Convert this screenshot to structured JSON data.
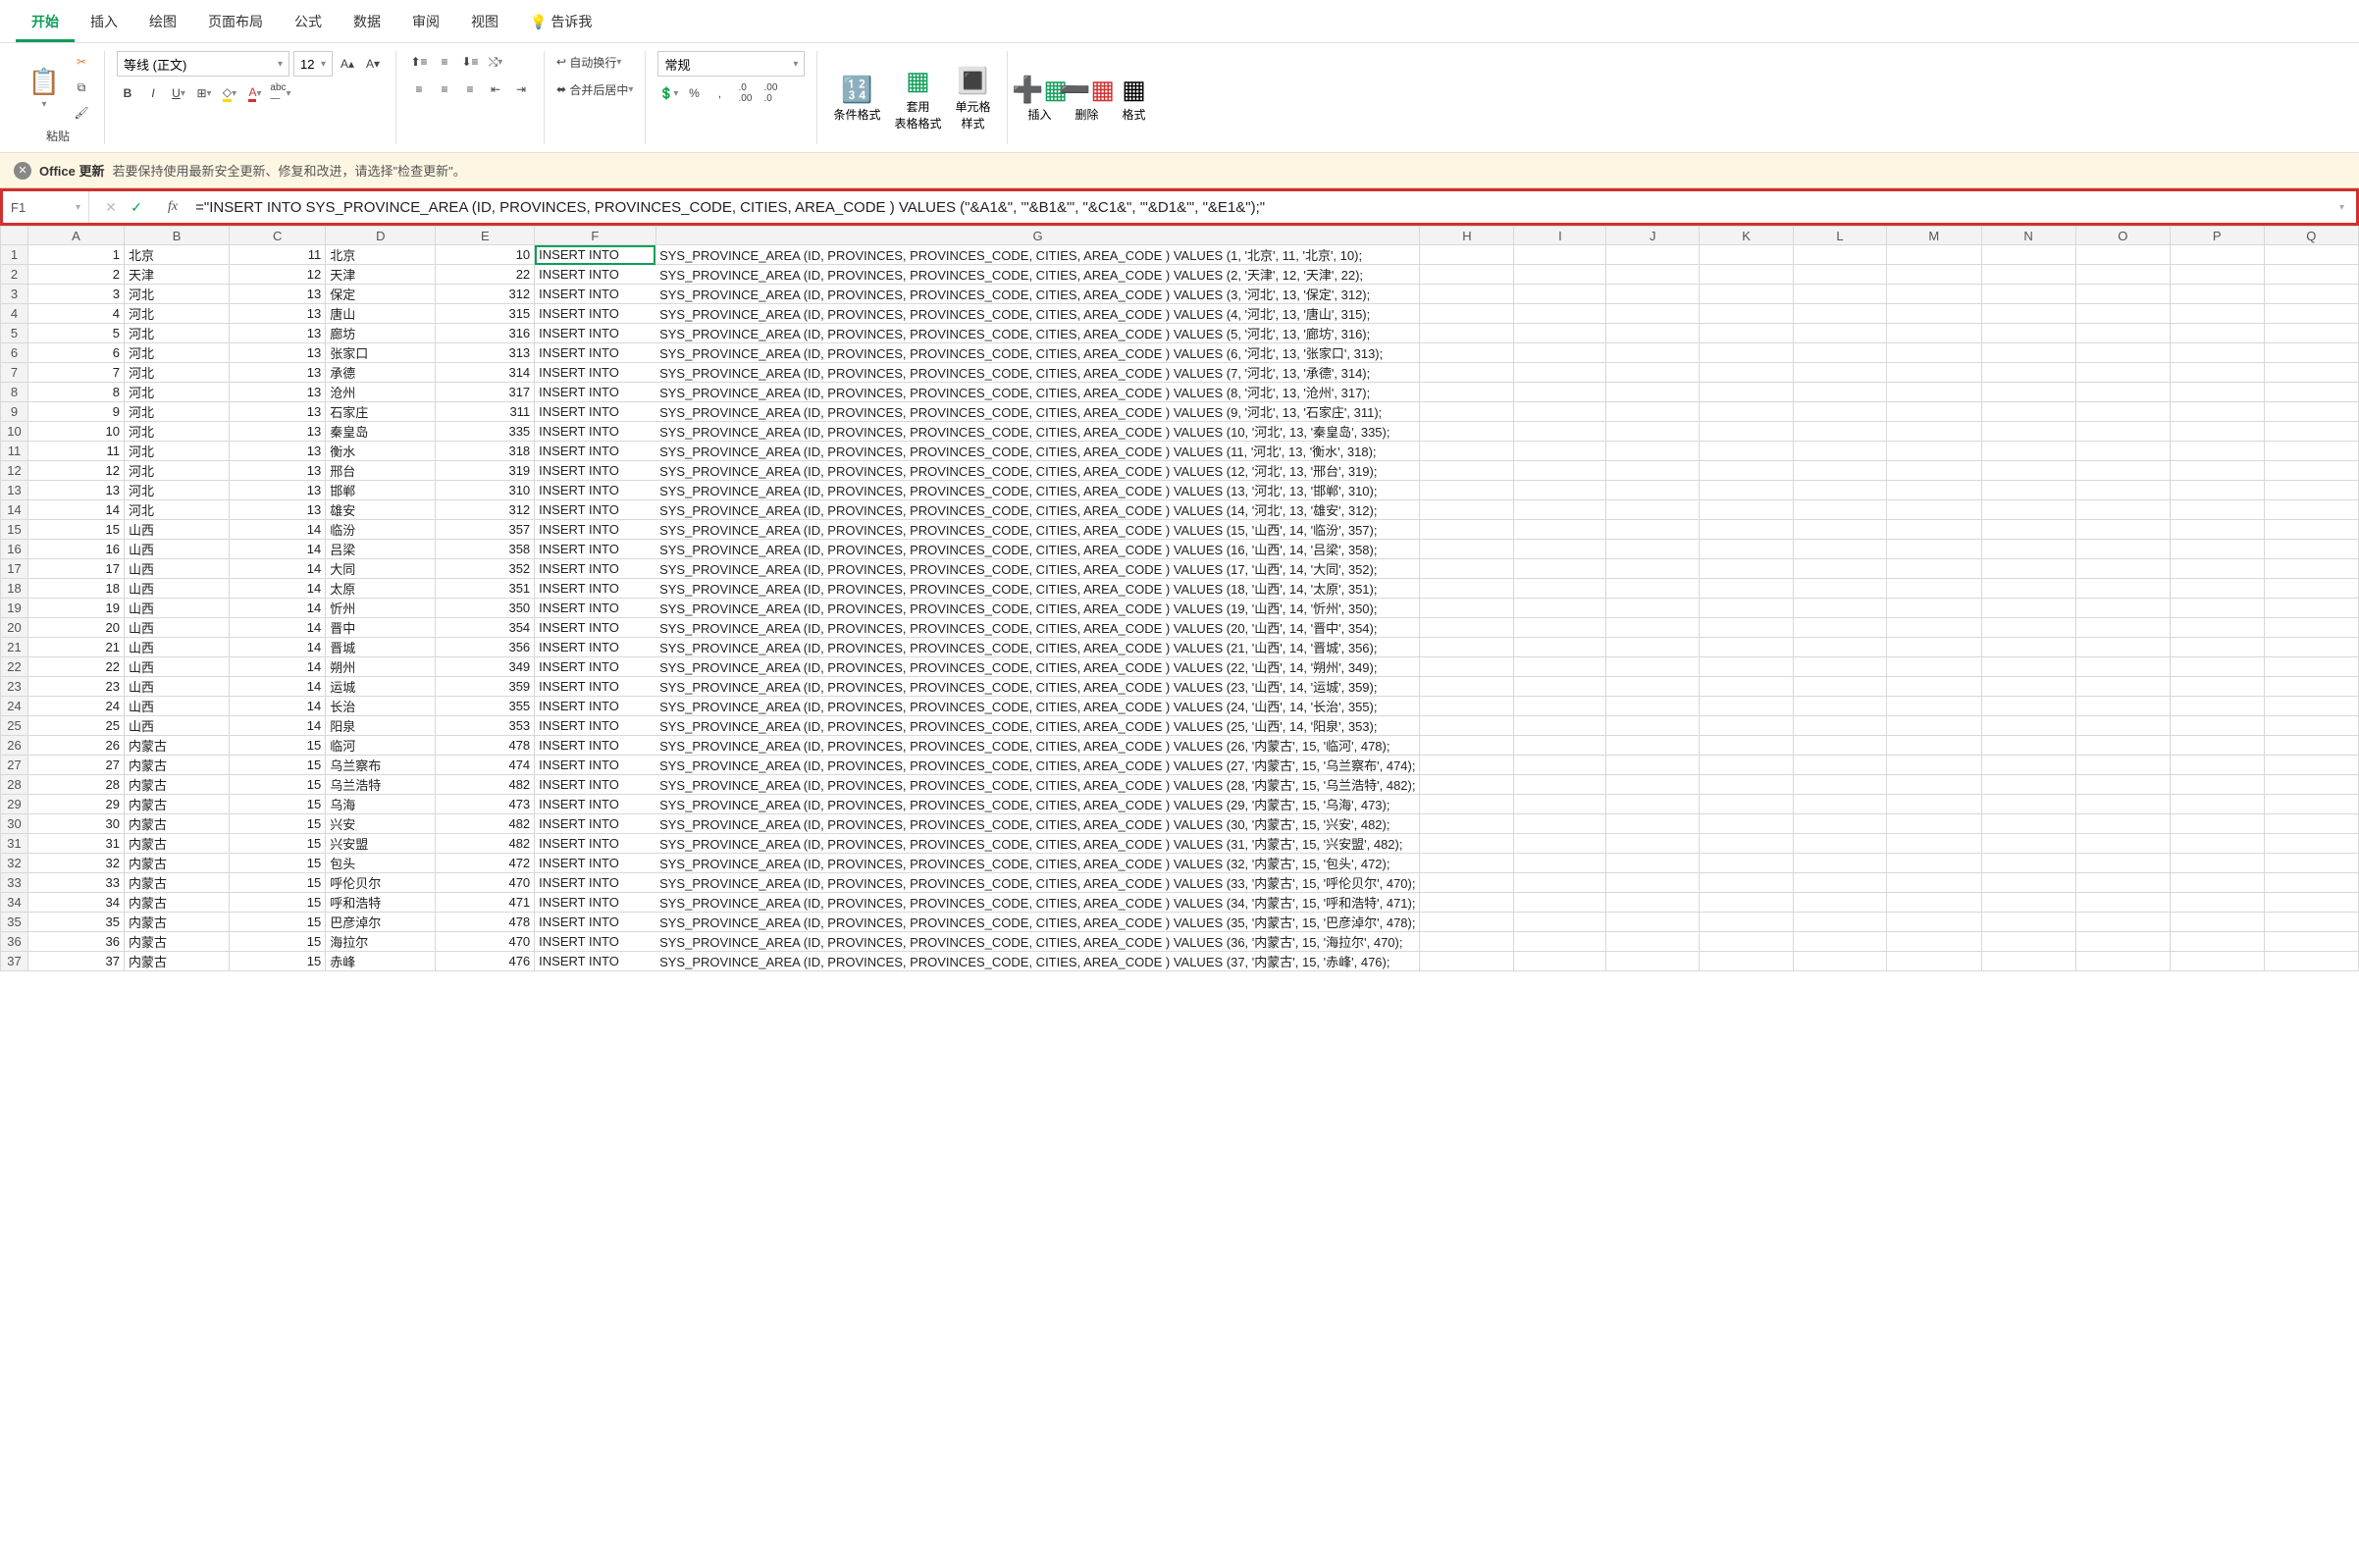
{
  "tabs": [
    "开始",
    "插入",
    "绘图",
    "页面布局",
    "公式",
    "数据",
    "审阅",
    "视图",
    "告诉我"
  ],
  "active_tab": 0,
  "ribbon": {
    "paste_label": "粘贴",
    "font_name": "等线 (正文)",
    "font_size": "12",
    "wrap_label": "自动换行",
    "merge_label": "合并后居中",
    "number_format": "常规",
    "cond_fmt": "条件格式",
    "table_fmt": "套用\n表格格式",
    "cell_style": "单元格\n样式",
    "insert": "插入",
    "delete": "删除",
    "format": "格式",
    "decimals_inc": ".0 .00",
    "decimals_dec": ".00 .0"
  },
  "update": {
    "title": "Office 更新",
    "text": "若要保持使用最新安全更新、修复和改进，请选择\"检查更新\"。"
  },
  "name_box": "F1",
  "formula": "=\"INSERT INTO SYS_PROVINCE_AREA (ID, PROVINCES, PROVINCES_CODE, CITIES, AREA_CODE ) VALUES (\"&A1&\", '\"&B1&\"', \"&C1&\", '\"&D1&\"', \"&E1&\");\"",
  "columns": [
    "A",
    "B",
    "C",
    "D",
    "E",
    "F",
    "G",
    "H",
    "I",
    "J",
    "K",
    "L",
    "M",
    "N",
    "O",
    "P",
    "Q"
  ],
  "selected_cell": {
    "row": 0,
    "col": 5
  },
  "sql_prefix": "INSERT INTO SYS_PROVINCE_AREA (ID, PROVINCES, PROVINCES_CODE, CITIES, AREA_CODE ) VALUES (",
  "sql_display_head": "INSERT INTO",
  "rows": [
    {
      "id": 1,
      "prov": "北京",
      "pcode": 11,
      "city": "北京",
      "acode": 10
    },
    {
      "id": 2,
      "prov": "天津",
      "pcode": 12,
      "city": "天津",
      "acode": 22
    },
    {
      "id": 3,
      "prov": "河北",
      "pcode": 13,
      "city": "保定",
      "acode": 312
    },
    {
      "id": 4,
      "prov": "河北",
      "pcode": 13,
      "city": "唐山",
      "acode": 315
    },
    {
      "id": 5,
      "prov": "河北",
      "pcode": 13,
      "city": "廊坊",
      "acode": 316
    },
    {
      "id": 6,
      "prov": "河北",
      "pcode": 13,
      "city": "张家口",
      "acode": 313
    },
    {
      "id": 7,
      "prov": "河北",
      "pcode": 13,
      "city": "承德",
      "acode": 314
    },
    {
      "id": 8,
      "prov": "河北",
      "pcode": 13,
      "city": "沧州",
      "acode": 317
    },
    {
      "id": 9,
      "prov": "河北",
      "pcode": 13,
      "city": "石家庄",
      "acode": 311
    },
    {
      "id": 10,
      "prov": "河北",
      "pcode": 13,
      "city": "秦皇岛",
      "acode": 335
    },
    {
      "id": 11,
      "prov": "河北",
      "pcode": 13,
      "city": "衡水",
      "acode": 318
    },
    {
      "id": 12,
      "prov": "河北",
      "pcode": 13,
      "city": "邢台",
      "acode": 319
    },
    {
      "id": 13,
      "prov": "河北",
      "pcode": 13,
      "city": "邯郸",
      "acode": 310
    },
    {
      "id": 14,
      "prov": "河北",
      "pcode": 13,
      "city": "雄安",
      "acode": 312
    },
    {
      "id": 15,
      "prov": "山西",
      "pcode": 14,
      "city": "临汾",
      "acode": 357
    },
    {
      "id": 16,
      "prov": "山西",
      "pcode": 14,
      "city": "吕梁",
      "acode": 358
    },
    {
      "id": 17,
      "prov": "山西",
      "pcode": 14,
      "city": "大同",
      "acode": 352
    },
    {
      "id": 18,
      "prov": "山西",
      "pcode": 14,
      "city": "太原",
      "acode": 351
    },
    {
      "id": 19,
      "prov": "山西",
      "pcode": 14,
      "city": "忻州",
      "acode": 350
    },
    {
      "id": 20,
      "prov": "山西",
      "pcode": 14,
      "city": "晋中",
      "acode": 354
    },
    {
      "id": 21,
      "prov": "山西",
      "pcode": 14,
      "city": "晋城",
      "acode": 356
    },
    {
      "id": 22,
      "prov": "山西",
      "pcode": 14,
      "city": "朔州",
      "acode": 349
    },
    {
      "id": 23,
      "prov": "山西",
      "pcode": 14,
      "city": "运城",
      "acode": 359
    },
    {
      "id": 24,
      "prov": "山西",
      "pcode": 14,
      "city": "长治",
      "acode": 355
    },
    {
      "id": 25,
      "prov": "山西",
      "pcode": 14,
      "city": "阳泉",
      "acode": 353
    },
    {
      "id": 26,
      "prov": "内蒙古",
      "pcode": 15,
      "city": "临河",
      "acode": 478
    },
    {
      "id": 27,
      "prov": "内蒙古",
      "pcode": 15,
      "city": "乌兰察布",
      "acode": 474
    },
    {
      "id": 28,
      "prov": "内蒙古",
      "pcode": 15,
      "city": "乌兰浩特",
      "acode": 482
    },
    {
      "id": 29,
      "prov": "内蒙古",
      "pcode": 15,
      "city": "乌海",
      "acode": 473
    },
    {
      "id": 30,
      "prov": "内蒙古",
      "pcode": 15,
      "city": "兴安",
      "acode": 482
    },
    {
      "id": 31,
      "prov": "内蒙古",
      "pcode": 15,
      "city": "兴安盟",
      "acode": 482
    },
    {
      "id": 32,
      "prov": "内蒙古",
      "pcode": 15,
      "city": "包头",
      "acode": 472
    },
    {
      "id": 33,
      "prov": "内蒙古",
      "pcode": 15,
      "city": "呼伦贝尔",
      "acode": 470
    },
    {
      "id": 34,
      "prov": "内蒙古",
      "pcode": 15,
      "city": "呼和浩特",
      "acode": 471
    },
    {
      "id": 35,
      "prov": "内蒙古",
      "pcode": 15,
      "city": "巴彦淖尔",
      "acode": 478
    },
    {
      "id": 36,
      "prov": "内蒙古",
      "pcode": 15,
      "city": "海拉尔",
      "acode": 470
    },
    {
      "id": 37,
      "prov": "内蒙古",
      "pcode": 15,
      "city": "赤峰",
      "acode": 476
    }
  ]
}
